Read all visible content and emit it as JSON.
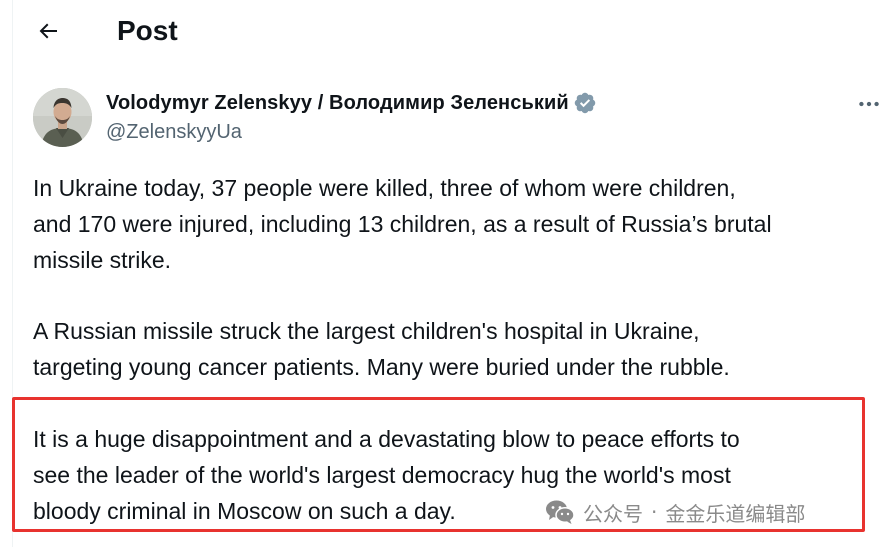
{
  "header": {
    "title": "Post",
    "back_icon": "arrow-left-icon"
  },
  "author": {
    "name": "Volodymyr Zelenskyy / Володимир Зеленський",
    "handle": "@ZelenskyyUa",
    "verified_icon": "verified-badge-icon",
    "verified_color": "#829aab"
  },
  "post": {
    "paragraph_1": "In Ukraine today, 37 people were killed, three of whom were children,\nand 170 were injured, including 13 children, as a result of Russia’s brutal\nmissile strike.",
    "paragraph_2": "A Russian missile struck the largest children's hospital in Ukraine,\ntargeting young cancer patients. Many were buried under the rubble.",
    "paragraph_3": "It is a huge disappointment and a devastating blow to peace efforts to\nsee the leader of the world's largest democracy hug the world's most\nbloody criminal in Moscow on such a day."
  },
  "highlight": {
    "color": "#e8332f"
  },
  "watermark": {
    "icon": "wechat-icon",
    "label": "公众号",
    "separator": "·",
    "account": "金金乐道编辑部"
  },
  "colors": {
    "text": "#0f1419",
    "secondary": "#536471"
  }
}
